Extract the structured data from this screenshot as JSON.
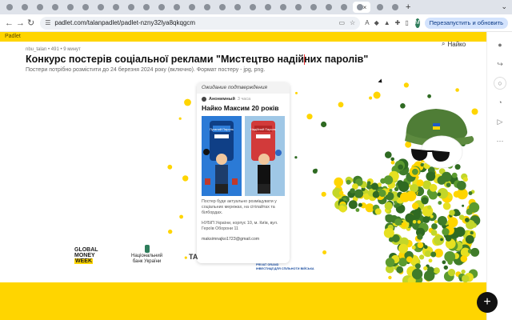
{
  "browser": {
    "tab_count": 26,
    "new_tab_symbol": "+",
    "address_url": "padlet.com/talanpadlet/padlet-nzny32lya8qkqgcm",
    "relaunch_label": "Перезапустить и обновить",
    "profile_initial": "M"
  },
  "padlet": {
    "brand": "Padlet",
    "meta": "nbu_talan • 491 • 9 минут",
    "title": "Конкурс постерів соціальної реклами \"Мистецтво надійних паролів\"",
    "subtitle": "Постери потрібно розмістити до 24 березня 2024 року (включно). Формат постеру - jpg, png.",
    "find_label": "Найко"
  },
  "post": {
    "status": "Ожидание подтверждения",
    "author": "Анонимный",
    "time_ago": "3 часа",
    "title": "Найко Максим 20 років",
    "poster_left_label": "Пуганий Пароль",
    "poster_right_label": "Надійний Пароль",
    "body": "Постер буде актуально розміщувати у соціальних мережах, на сітілайтах та білбордах.",
    "address": "НУБІП України, корпус 10, м. Київ, вул. Героїв Оборони 11",
    "email": "maksimnajko1723@gmail.com"
  },
  "logos": {
    "gmw_line1": "GLOBAL",
    "gmw_line2": "MONEY",
    "gmw_line3": "WEEK",
    "nbu_line1": "Національний",
    "nbu_line2": "банк України",
    "partial": "TA",
    "pr_line1": "PRIVAT GRAND",
    "pr_line2": "ІНВЕСТИЦІЇ ДЛЯ СПІЛЬНОТИ ВІЙСЬКА"
  },
  "fab_symbol": "+",
  "colors": {
    "yellow": "#ffd500",
    "helmet_green": "#4f7d36",
    "camo_green": "#3f7c2a",
    "camo_lime": "#c3d629",
    "fab": "#111111"
  }
}
